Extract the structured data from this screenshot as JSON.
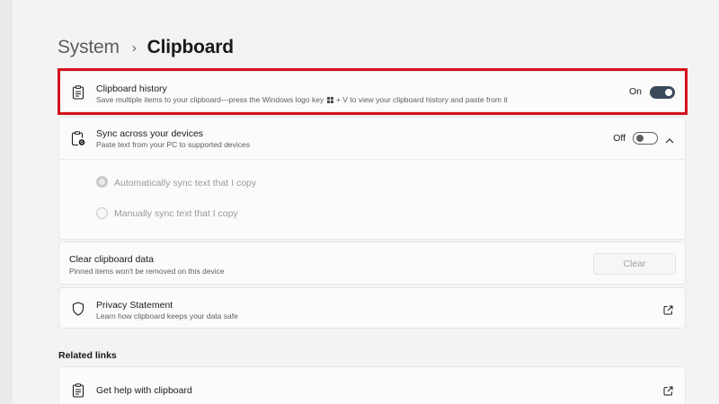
{
  "breadcrumb": {
    "parent": "System",
    "separator": "›",
    "current": "Clipboard"
  },
  "clipboard_history": {
    "title": "Clipboard history",
    "desc_before_key": "Save multiple items to your clipboard—press the Windows logo key",
    "desc_after_key": "+ V to view your clipboard history and paste from it",
    "toggle_label": "On",
    "toggle_state": "on",
    "icon": "clipboard-icon"
  },
  "sync": {
    "title": "Sync across your devices",
    "desc": "Paste text from your PC to supported devices",
    "toggle_label": "Off",
    "toggle_state": "off",
    "expanded": true,
    "icon": "clipboard-sync-icon",
    "options": [
      {
        "label": "Automatically sync text that I copy",
        "selected": true,
        "disabled": true
      },
      {
        "label": "Manually sync text that I copy",
        "selected": false,
        "disabled": true
      }
    ]
  },
  "clear_data": {
    "title": "Clear clipboard data",
    "desc": "Pinned items won't be removed on this device",
    "button_label": "Clear",
    "button_disabled": true
  },
  "privacy": {
    "title": "Privacy Statement",
    "desc": "Learn how clipboard keeps your data safe",
    "icon": "shield-icon"
  },
  "related_links": {
    "heading": "Related links",
    "items": [
      {
        "label": "Get help with clipboard",
        "icon": "clipboard-icon"
      }
    ]
  },
  "colors": {
    "highlight": "#d4101a",
    "toggle_on": "#3b4a5a",
    "background": "#f3f3f3"
  }
}
